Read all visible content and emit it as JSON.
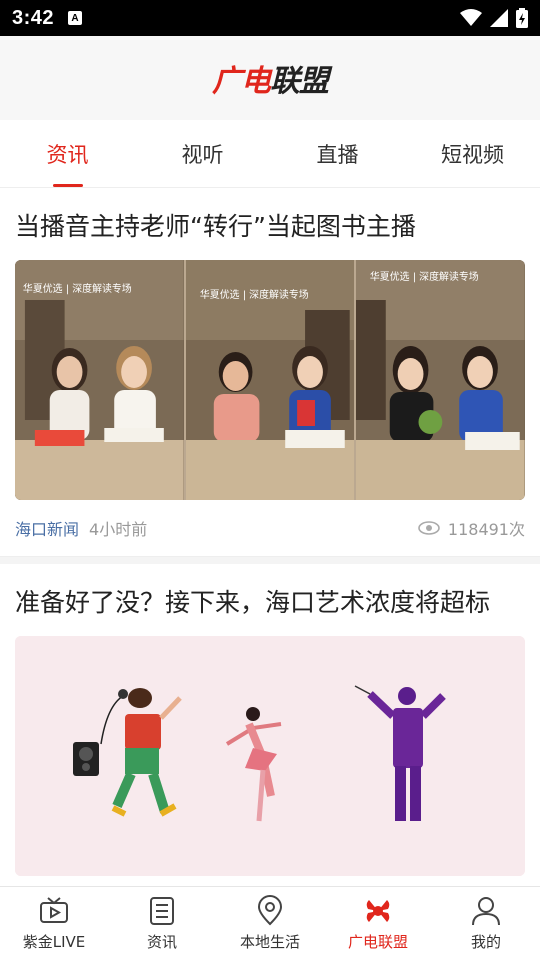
{
  "status": {
    "time": "3:42",
    "indicator": "A"
  },
  "header": {
    "logo_part1": "广电",
    "logo_part2": "联盟"
  },
  "tabs": [
    {
      "label": "资讯",
      "active": true
    },
    {
      "label": "视听",
      "active": false
    },
    {
      "label": "直播",
      "active": false
    },
    {
      "label": "短视频",
      "active": false
    }
  ],
  "articles": [
    {
      "title": "当播音主持老师“转行”当起图书主播",
      "source": "海口新闻",
      "time": "4小时前",
      "views": "118491次"
    },
    {
      "title": "准备好了没？接下来，海口艺术浓度将超标"
    }
  ],
  "image1": {
    "banner": "华夏优选 | 深度解读专场"
  },
  "bottom_nav": [
    {
      "label": "紫金LIVE",
      "icon": "tv-icon"
    },
    {
      "label": "资讯",
      "icon": "news-list-icon"
    },
    {
      "label": "本地生活",
      "icon": "location-pin-icon"
    },
    {
      "label": "广电联盟",
      "icon": "alliance-icon",
      "active": true
    },
    {
      "label": "我的",
      "icon": "user-icon"
    }
  ],
  "colors": {
    "accent": "#e0261c",
    "source_blue": "#4a6fa5"
  }
}
